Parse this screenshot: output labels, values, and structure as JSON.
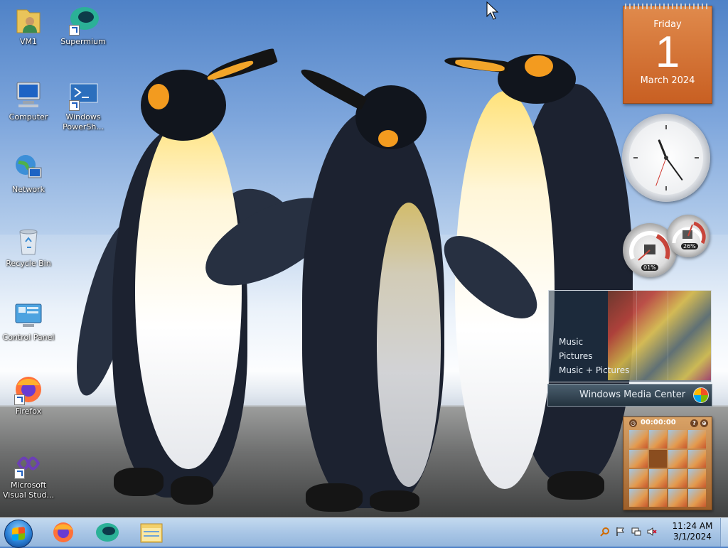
{
  "desktop": {
    "icons": [
      {
        "name": "VM1",
        "glyph": "user-folder-icon",
        "shortcut": false
      },
      {
        "name": "Supermium",
        "glyph": "supermium-icon",
        "shortcut": true
      },
      {
        "name": "Computer",
        "glyph": "computer-icon",
        "shortcut": false
      },
      {
        "name": "Windows PowerSh...",
        "glyph": "powershell-icon",
        "shortcut": true
      },
      {
        "name": "Network",
        "glyph": "network-icon",
        "shortcut": false
      },
      {
        "name": "Recycle Bin",
        "glyph": "recycle-bin-icon",
        "shortcut": false
      },
      {
        "name": "Control Panel",
        "glyph": "control-panel-icon",
        "shortcut": false
      },
      {
        "name": "Firefox",
        "glyph": "firefox-icon",
        "shortcut": true
      },
      {
        "name": "Microsoft Visual Stud...",
        "glyph": "visual-studio-icon",
        "shortcut": true
      }
    ]
  },
  "gadgets": {
    "calendar": {
      "weekday": "Friday",
      "day": "1",
      "month_year": "March 2024"
    },
    "clock": {
      "hour_hand_deg": 338,
      "minute_hand_deg": 144,
      "second_hand_deg": 200
    },
    "meters": {
      "cpu": "01%",
      "ram": "26%"
    },
    "media_center": {
      "menu": [
        "Music",
        "Pictures",
        "Music + Pictures"
      ],
      "title": "Windows Media Center"
    },
    "puzzle": {
      "timer": "00:00:00",
      "help": "?",
      "toggle": "⊕"
    }
  },
  "taskbar": {
    "start_label": "Start",
    "pinned": [
      "firefox-icon",
      "supermium-icon",
      "file-explorer-icon"
    ],
    "tray": {
      "icons": [
        "search-icon",
        "action-center-flag-icon",
        "network-icon",
        "volume-muted-icon"
      ],
      "time": "11:24 AM",
      "date": "3/1/2024"
    }
  },
  "colors": {
    "taskbar": "#a9c6e6",
    "calendar": "#d7763a",
    "clock_second_hand": "#d0372f"
  }
}
